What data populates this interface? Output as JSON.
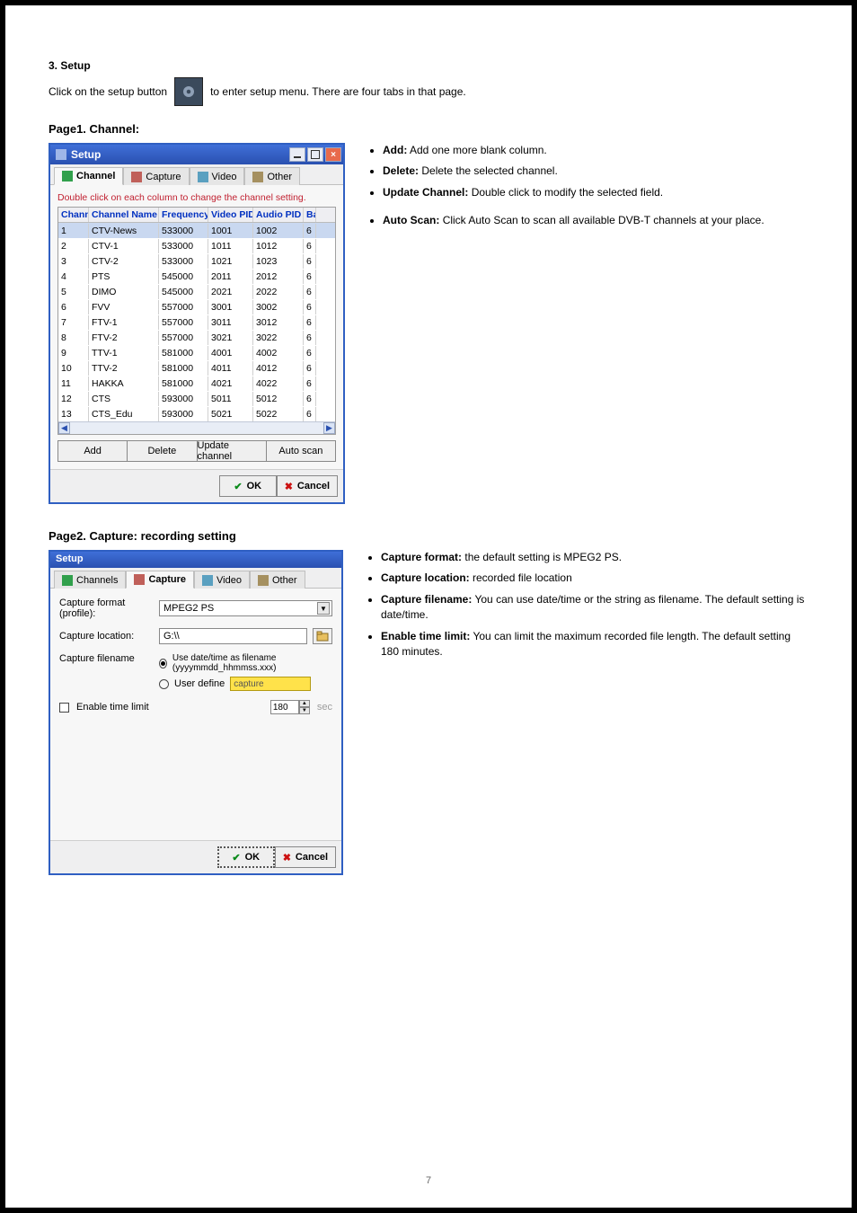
{
  "intro": {
    "line1": "3. Setup",
    "line2_pre": "Click on the setup button",
    "line2_post": "to enter setup menu. There are four tabs in that page."
  },
  "channel_section": {
    "title": "Page1. Channel:",
    "bullets": [
      "Add: Add one more blank column.",
      "Delete: Delete the selected channel.",
      "Update Channel: Double click to modify the selected field.",
      "Auto Scan: Click Auto Scan to scan all available DVB-T channels at your place."
    ]
  },
  "win1": {
    "title": "Setup",
    "tabs": [
      "Channel",
      "Capture",
      "Video",
      "Other"
    ],
    "hint": "Double click on each column to change the channel setting.",
    "columns": [
      "Channel",
      "Channel Name",
      "Frequency",
      "Video PID",
      "Audio PID",
      "Ba"
    ],
    "rows": [
      {
        "ch": "1",
        "name": "CTV-News",
        "freq": "533000",
        "vpid": "1001",
        "apid": "1002",
        "ba": "6"
      },
      {
        "ch": "2",
        "name": "CTV-1",
        "freq": "533000",
        "vpid": "1011",
        "apid": "1012",
        "ba": "6"
      },
      {
        "ch": "3",
        "name": "CTV-2",
        "freq": "533000",
        "vpid": "1021",
        "apid": "1023",
        "ba": "6"
      },
      {
        "ch": "4",
        "name": "PTS",
        "freq": "545000",
        "vpid": "2011",
        "apid": "2012",
        "ba": "6"
      },
      {
        "ch": "5",
        "name": "DIMO",
        "freq": "545000",
        "vpid": "2021",
        "apid": "2022",
        "ba": "6"
      },
      {
        "ch": "6",
        "name": "FVV",
        "freq": "557000",
        "vpid": "3001",
        "apid": "3002",
        "ba": "6"
      },
      {
        "ch": "7",
        "name": "FTV-1",
        "freq": "557000",
        "vpid": "3011",
        "apid": "3012",
        "ba": "6"
      },
      {
        "ch": "8",
        "name": "FTV-2",
        "freq": "557000",
        "vpid": "3021",
        "apid": "3022",
        "ba": "6"
      },
      {
        "ch": "9",
        "name": "TTV-1",
        "freq": "581000",
        "vpid": "4001",
        "apid": "4002",
        "ba": "6"
      },
      {
        "ch": "10",
        "name": "TTV-2",
        "freq": "581000",
        "vpid": "4011",
        "apid": "4012",
        "ba": "6"
      },
      {
        "ch": "11",
        "name": "HAKKA",
        "freq": "581000",
        "vpid": "4021",
        "apid": "4022",
        "ba": "6"
      },
      {
        "ch": "12",
        "name": "CTS",
        "freq": "593000",
        "vpid": "5011",
        "apid": "5012",
        "ba": "6"
      },
      {
        "ch": "13",
        "name": "CTS_Edu",
        "freq": "593000",
        "vpid": "5021",
        "apid": "5022",
        "ba": "6"
      }
    ],
    "btns": [
      "Add",
      "Delete",
      "Update channel",
      "Auto scan"
    ],
    "ok": "OK",
    "cancel": "Cancel"
  },
  "capture_section": {
    "title": "Page2. Capture: recording setting",
    "bullets": [
      "Capture format: the default setting is MPEG2 PS.",
      "Capture location: recorded file location",
      "Capture filename: You can use date/time or the string as filename. The default setting is date/time.",
      "Enable time limit: You can limit the maximum recorded file length. The default setting 180 minutes."
    ]
  },
  "win2": {
    "title": "Setup",
    "tabs": [
      "Channels",
      "Capture",
      "Video",
      "Other"
    ],
    "format_label": "Capture format (profile):",
    "format_value": "MPEG2 PS",
    "location_label": "Capture location:",
    "location_value": "G:\\\\",
    "filename_label": "Capture filename",
    "radio_date": "Use date/time as filename (yyyymmdd_hhmmss.xxx)",
    "radio_user": "User define",
    "user_value": "capture",
    "enable_time": "Enable time limit",
    "time_value": "180",
    "time_unit": "sec",
    "ok": "OK",
    "cancel": "Cancel"
  },
  "page_number": "7"
}
